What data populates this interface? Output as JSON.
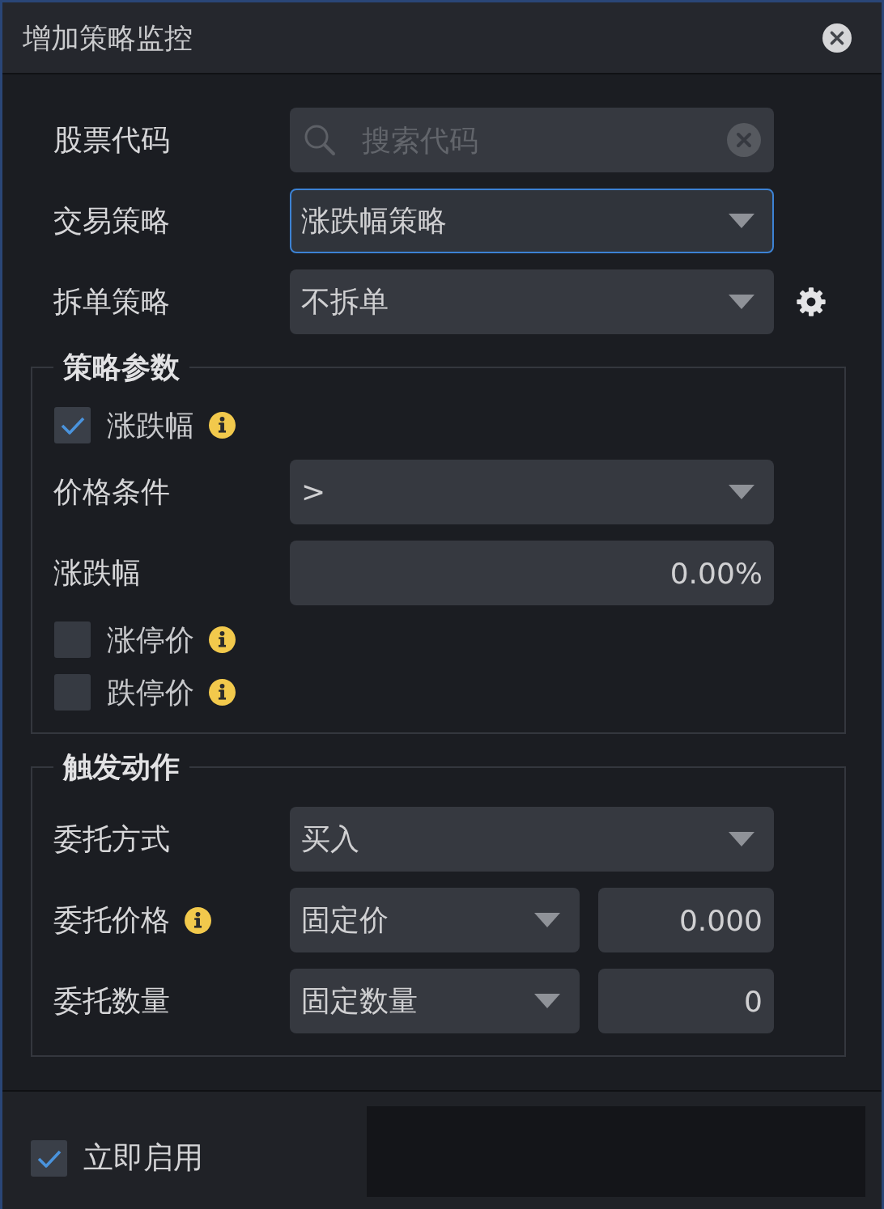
{
  "window": {
    "title": "增加策略监控"
  },
  "fields": [
    {
      "kind": "search",
      "label": "股票代码",
      "placeholder": "搜索代码",
      "focused": false,
      "settings": false
    },
    {
      "kind": "select",
      "label": "交易策略",
      "value": "涨跌幅策略",
      "focused": true,
      "settings": false
    },
    {
      "kind": "select",
      "label": "拆单策略",
      "value": "不拆单",
      "focused": false,
      "settings": true
    }
  ],
  "groups": [
    {
      "legend": "策略参数",
      "rows": [
        {
          "kind": "checkbox",
          "label": "涨跌幅",
          "checked": true,
          "info": true
        },
        {
          "kind": "select",
          "label": "价格条件",
          "value": ">"
        },
        {
          "kind": "input",
          "label": "涨跌幅",
          "value": "0.00%"
        },
        {
          "kind": "checkbox",
          "label": "涨停价",
          "checked": false,
          "info": true
        },
        {
          "kind": "checkbox",
          "label": "跌停价",
          "checked": false,
          "info": true
        }
      ]
    },
    {
      "legend": "触发动作",
      "rows": [
        {
          "kind": "select",
          "label": "委托方式",
          "value": "买入"
        },
        {
          "kind": "split",
          "label": "委托价格",
          "info": true,
          "option": "固定价",
          "value": "0.000"
        },
        {
          "kind": "split",
          "label": "委托数量",
          "info": false,
          "option": "固定数量",
          "value": "0"
        }
      ]
    }
  ],
  "footer": {
    "enable": {
      "label": "立即启用",
      "checked": true
    }
  }
}
